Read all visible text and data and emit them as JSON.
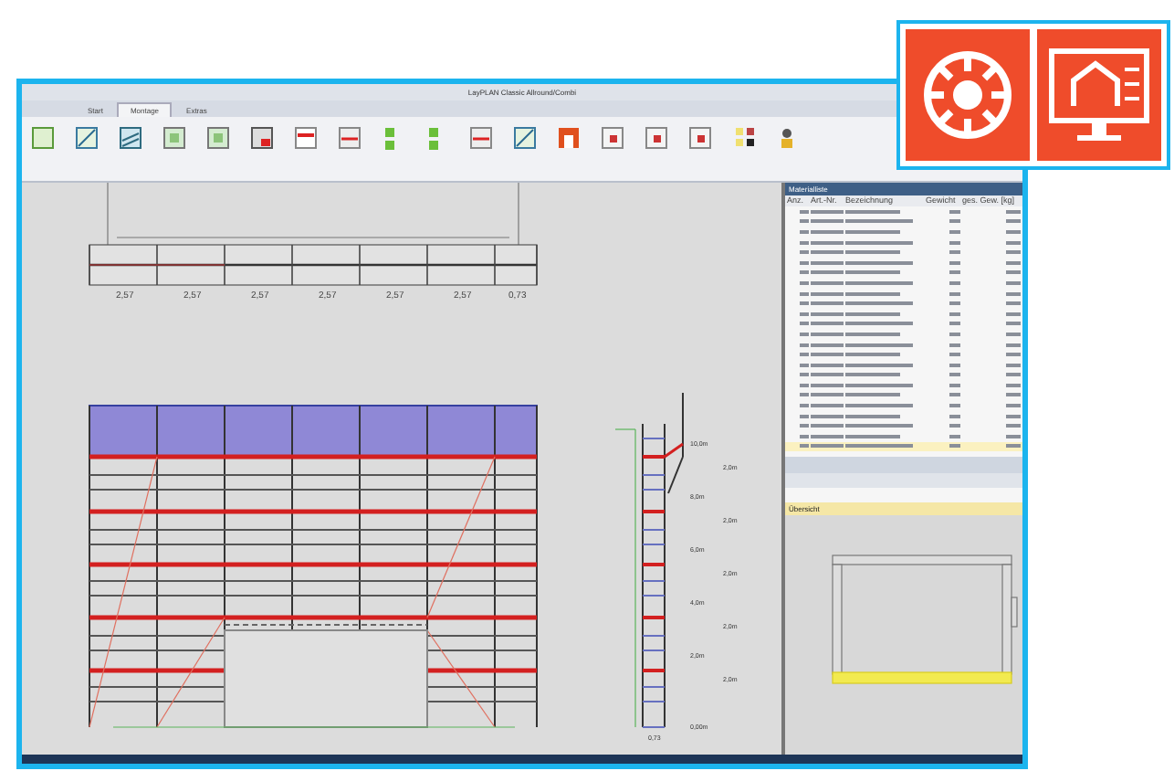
{
  "window": {
    "title": "LayPLAN Classic Allround/Combi"
  },
  "tabs": [
    {
      "label": "Start",
      "selected": false
    },
    {
      "label": "Montage",
      "selected": true
    },
    {
      "label": "Extras",
      "selected": false
    }
  ],
  "ribbon_buttons": [
    {
      "kind": "frame"
    },
    {
      "kind": "diagonal"
    },
    {
      "kind": "stripes"
    },
    {
      "kind": "deck"
    },
    {
      "kind": "deck"
    },
    {
      "kind": "railing"
    },
    {
      "kind": "panel"
    },
    {
      "kind": "level"
    },
    {
      "kind": "checks"
    },
    {
      "kind": "checks"
    },
    {
      "kind": "level"
    },
    {
      "kind": "diagonal"
    },
    {
      "kind": "stop"
    },
    {
      "kind": "tool"
    },
    {
      "kind": "tool"
    },
    {
      "kind": "tool"
    },
    {
      "kind": "stack"
    },
    {
      "kind": "person"
    }
  ],
  "drawing": {
    "plan_labels": [
      "2,57",
      "2,57",
      "2,57",
      "2,57",
      "2,57",
      "2,57",
      "0,73"
    ],
    "height_labels": [
      "10,0m",
      "8,0m",
      "6,0m",
      "4,0m",
      "2,0m",
      "0,00m"
    ],
    "spacing_labels": [
      "2,0m",
      "2,0m",
      "2,0m",
      "2,0m",
      "2,0m"
    ],
    "width_label": "0,73"
  },
  "material_list": {
    "title": "Materialliste",
    "columns": [
      "Anz.",
      "Art.-Nr.",
      "Bezeichnung",
      "Gewicht",
      "ges. Gew. [kg]"
    ],
    "rows": [
      {
        "selected": false
      },
      {
        "selected": false
      },
      {
        "selected": false
      },
      {
        "selected": false
      },
      {
        "selected": false
      },
      {
        "selected": false
      },
      {
        "selected": false
      },
      {
        "selected": false
      },
      {
        "selected": false
      },
      {
        "selected": false
      },
      {
        "selected": false
      },
      {
        "selected": false
      },
      {
        "selected": false
      },
      {
        "selected": false
      },
      {
        "selected": false
      },
      {
        "selected": false
      },
      {
        "selected": false
      },
      {
        "selected": false
      },
      {
        "selected": false
      },
      {
        "selected": false
      },
      {
        "selected": false
      },
      {
        "selected": false
      },
      {
        "selected": false
      },
      {
        "selected": true
      }
    ]
  },
  "overview": {
    "title": "Übersicht"
  }
}
